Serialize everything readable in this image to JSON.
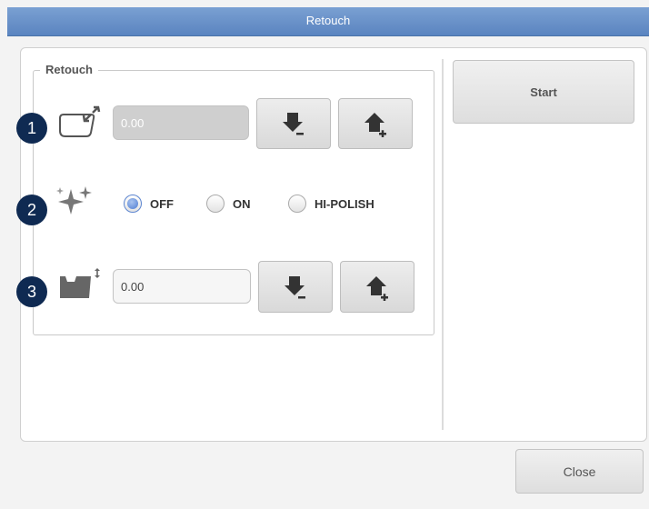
{
  "window": {
    "title": "Retouch"
  },
  "group": {
    "legend": "Retouch"
  },
  "rows": [
    {
      "badge": "1",
      "icon": "size-adjust-icon",
      "value": "0.00"
    },
    {
      "badge": "2",
      "icon": "sparkle-polish-icon",
      "radio_options": [
        "OFF",
        "ON",
        "HI-POLISH"
      ],
      "selected": "OFF"
    },
    {
      "badge": "3",
      "icon": "bevel-position-icon",
      "value": "0.00"
    }
  ],
  "buttons": {
    "start": "Start",
    "close": "Close"
  },
  "colors": {
    "titlebar": "#5a84c0",
    "badge": "#0f2a52",
    "radio_selected": "#4d7bd1"
  }
}
